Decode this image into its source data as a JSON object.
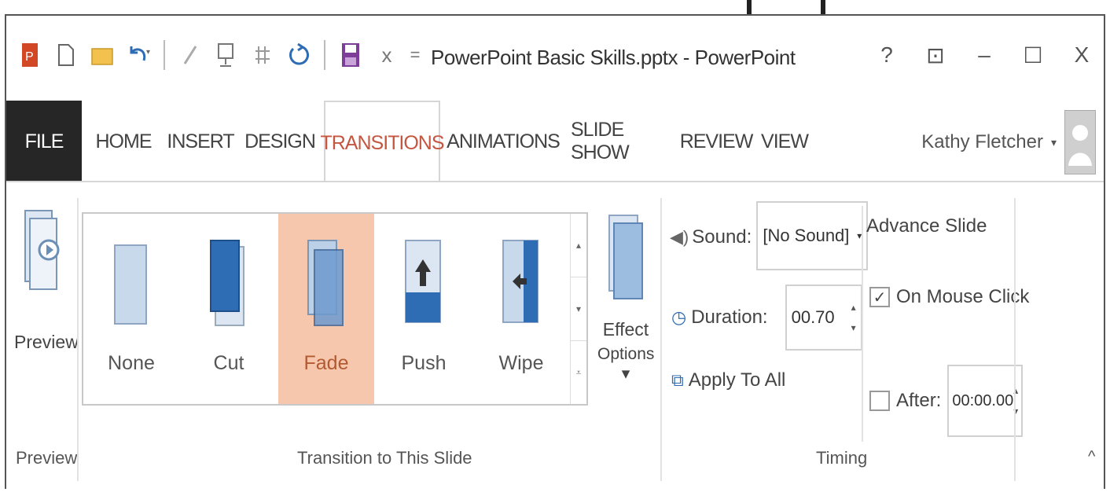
{
  "window": {
    "title": "PowerPoint Basic Skills.pptx - PowerPoint",
    "controls": {
      "help": "?",
      "restore_ribbon": "⊡",
      "minimize": "–",
      "maximize": "☐",
      "close": "X"
    }
  },
  "qat": {
    "icons": [
      "powerpoint-logo-icon",
      "new-icon",
      "open-icon",
      "undo-icon",
      "pen-icon",
      "present-icon",
      "pin-icon",
      "redo-icon",
      "save-icon",
      "close-doc-icon",
      "customize-icon"
    ],
    "close_glyph": "x",
    "customize_glyph": "="
  },
  "tabs": [
    "FILE",
    "HOME",
    "INSERT",
    "DESIGN",
    "TRANSITIONS",
    "ANIMATIONS",
    "SLIDE SHOW",
    "REVIEW",
    "VIEW"
  ],
  "active_tab": "TRANSITIONS",
  "user": {
    "name": "Kathy Fletcher",
    "caret": "▾"
  },
  "ribbon": {
    "preview": {
      "button_label": "Preview",
      "group_label": "Preview"
    },
    "transitions": {
      "items": [
        "None",
        "Cut",
        "Fade",
        "Push",
        "Wipe"
      ],
      "selected": "Fade",
      "effect_options_line1": "Effect",
      "effect_options_line2": "Options ▾",
      "group_label": "Transition to This Slide"
    },
    "timing": {
      "sound_label": "Sound:",
      "sound_value": "[No Sound]",
      "duration_label": "Duration:",
      "duration_value": "00.70",
      "apply_all_label": "Apply To All",
      "advance_title": "Advance Slide",
      "on_mouse_click_label": "On Mouse Click",
      "on_mouse_click_checked": "✓",
      "after_label": "After:",
      "after_value": "00:00.00",
      "group_label": "Timing",
      "collapse_glyph": "^"
    }
  },
  "colors": {
    "accent": "#c5563f",
    "selected_bg": "#f7c7ad",
    "file_tab": "#262626",
    "thumb_blue": "#2e6db4"
  }
}
